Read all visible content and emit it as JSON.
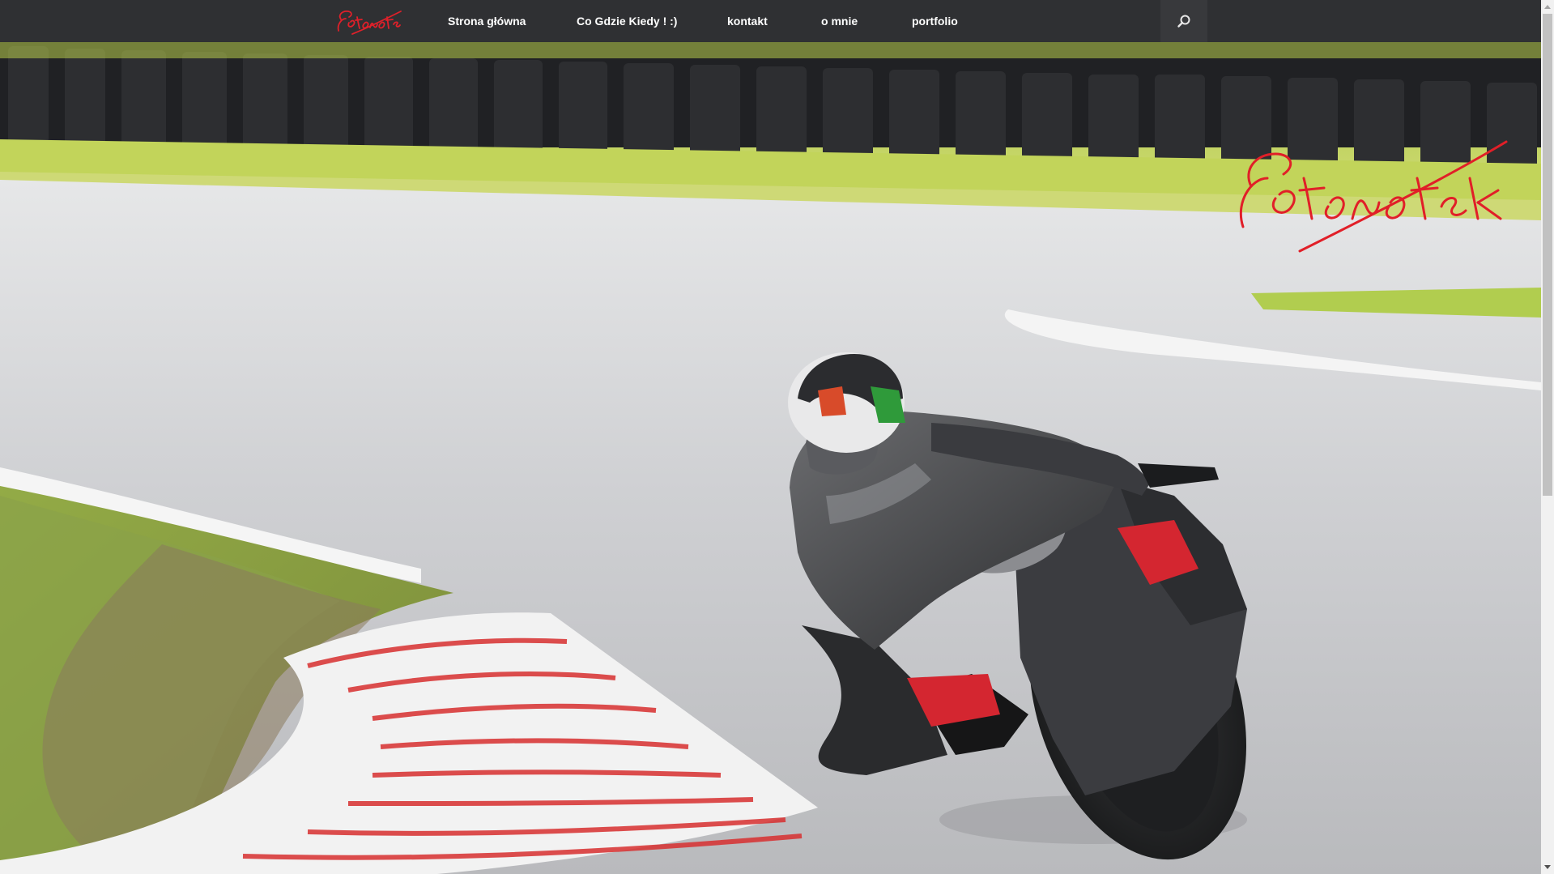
{
  "nav": {
    "logo_alt": "fotonotek.pl",
    "items": [
      {
        "label": "Strona główna"
      },
      {
        "label": "Co Gdzie Kiedy ! :)"
      },
      {
        "label": "kontakt"
      },
      {
        "label": "o mnie"
      },
      {
        "label": "portfolio"
      }
    ],
    "search_icon": "search-icon"
  },
  "hero": {
    "image": "motorcycle rider leaning into a corner on a race track",
    "watermark": "fotonotek.pl"
  },
  "colors": {
    "navbar": "#2f3033",
    "nav_text": "#ffffff",
    "logo_red": "#e0202a",
    "track": "#cfd0d2",
    "grass": "#9ec23a"
  },
  "scrollbar": {
    "icons": [
      "chevron-up-icon",
      "chevron-down-icon"
    ]
  }
}
